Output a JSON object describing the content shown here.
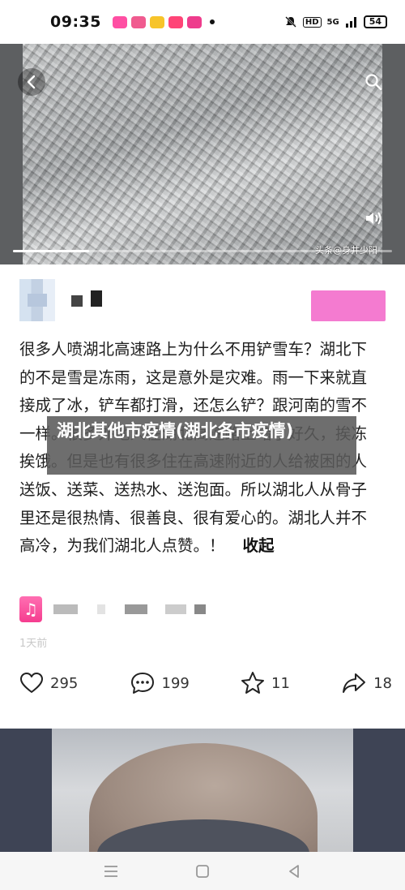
{
  "status_bar": {
    "time": "09:35",
    "apps": [
      {
        "icon": "app-icon-1",
        "color": "#ff4fa3"
      },
      {
        "icon": "app-icon-2",
        "color": "#f05b8f"
      },
      {
        "icon": "app-icon-3",
        "color": "#f7c42a"
      },
      {
        "icon": "app-icon-4",
        "color": "#ff4477"
      },
      {
        "icon": "app-icon-5",
        "color": "#ee3c8c"
      }
    ],
    "network": "5G",
    "hd": "HD",
    "battery": "54"
  },
  "video": {
    "watermark": "头条@身井少阳",
    "progress_fraction": 0.2
  },
  "author": {
    "follow_color": "#f47bd0"
  },
  "post": {
    "text": "很多人喷湖北高速路上为什么不用铲雪车？湖北下的不是雪是冻雨，这是意外是灾难。雨一下来就直接成了冰，铲车都打滑，还怎么铲？跟河南的雪不一样。很多外地人在湖北高速路上堵了好久，挨冻挨饿。但是也有很多住在高速附近的人给被困的人送饭、送菜、送热水、送泡面。所以湖北人从骨子里还是很热情、很善良、很有爱心的。湖北人并不高冷，为我们湖北人点赞。！",
    "collapse_label": "收起",
    "overlay_title": "湖北其他市疫情(湖北各市疫情)",
    "time_ago": "1天前"
  },
  "actions": {
    "like_count": "295",
    "comment_count": "199",
    "favorite_count": "11",
    "share_count": "18"
  }
}
